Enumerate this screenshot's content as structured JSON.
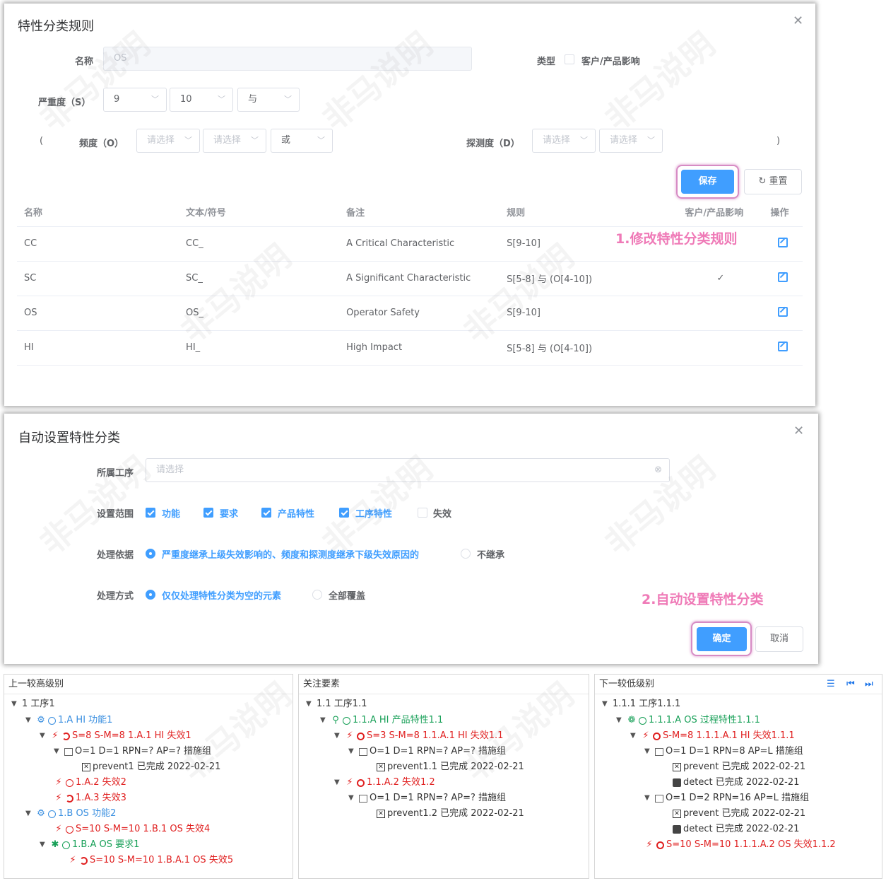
{
  "dialog1": {
    "title": "特性分类规则",
    "name_label": "名称",
    "name_value": "OS",
    "type_label": "类型",
    "type_checkbox_label": "客户/产品影响",
    "severity_label": "严重度（S）",
    "severity_from": "9",
    "severity_to": "10",
    "severity_logic": "与",
    "open_paren": "(",
    "close_paren": ")",
    "occurrence_label": "频度（O）",
    "occurrence_from": "请选择",
    "occurrence_to": "请选择",
    "occurrence_logic": "或",
    "detection_label": "探测度（D）",
    "detection_from": "请选择",
    "detection_to": "请选择",
    "save_label": "保存",
    "reset_label": "重置",
    "annotation": "1.修改特性分类规则",
    "columns": [
      "名称",
      "文本/符号",
      "备注",
      "规则",
      "客户/产品影响",
      "操作"
    ],
    "rows": [
      {
        "name": "CC",
        "symbol": "CC_",
        "note": "A Critical Characteristic",
        "rule": "S[9-10]",
        "customer": ""
      },
      {
        "name": "SC",
        "symbol": "SC_",
        "note": "A Significant Characteristic",
        "rule": "S[5-8] 与 (O[4-10])",
        "customer": "✓"
      },
      {
        "name": "OS",
        "symbol": "OS_",
        "note": "Operator Safety",
        "rule": "S[9-10]",
        "customer": ""
      },
      {
        "name": "HI",
        "symbol": "HI_",
        "note": "High Impact",
        "rule": "S[5-8] 与 (O[4-10])",
        "customer": ""
      }
    ]
  },
  "dialog2": {
    "title": "自动设置特性分类",
    "process_label": "所属工序",
    "process_placeholder": "请选择",
    "scope_label": "设置范围",
    "scope_items": [
      {
        "label": "功能",
        "checked": true
      },
      {
        "label": "要求",
        "checked": true
      },
      {
        "label": "产品特性",
        "checked": true
      },
      {
        "label": "工序特性",
        "checked": true
      },
      {
        "label": "失效",
        "checked": false
      }
    ],
    "basis_label": "处理依据",
    "basis_option1": "严重度继承上级失效影响的、频度和探测度继承下级失效原因的",
    "basis_option2": "不继承",
    "mode_label": "处理方式",
    "mode_option1": "仅仅处理特性分类为空的元素",
    "mode_option2": "全部覆盖",
    "annotation": "2.自动设置特性分类",
    "confirm_label": "确定",
    "cancel_label": "取消"
  },
  "panels": {
    "left": {
      "title": "上一较高级别",
      "nodes": [
        {
          "text": "1 工序1"
        },
        {
          "text": "1.A HI 功能1"
        },
        {
          "text": "S=8 S-M=8 1.A.1 HI 失效1"
        },
        {
          "text": "O=1 D=1 RPN=? AP=? 措施组"
        },
        {
          "text": "prevent1 已完成 2022-02-21"
        },
        {
          "text": "1.A.2 失效2"
        },
        {
          "text": "1.A.3 失效3"
        },
        {
          "text": "1.B OS 功能2"
        },
        {
          "text": "S=10 S-M=10 1.B.1 OS 失效4"
        },
        {
          "text": "1.B.A OS 要求1"
        },
        {
          "text": "S=10 S-M=10 1.B.A.1 OS 失效5"
        }
      ]
    },
    "middle": {
      "title": "关注要素",
      "nodes": [
        {
          "text": "1.1 工序1.1"
        },
        {
          "text": "1.1.A HI 产品特性1.1"
        },
        {
          "text": "S=3 S-M=8 1.1.A.1 HI 失效1.1"
        },
        {
          "text": "O=1 D=1 RPN=? AP=? 措施组"
        },
        {
          "text": "prevent1.1 已完成 2022-02-21"
        },
        {
          "text": "1.1.A.2 失效1.2"
        },
        {
          "text": "O=1 D=1 RPN=? AP=? 措施组"
        },
        {
          "text": "prevent1.2 已完成 2022-02-21"
        }
      ]
    },
    "right": {
      "title": "下一较低级别",
      "nodes": [
        {
          "text": "1.1.1 工序1.1.1"
        },
        {
          "text": "1.1.1.A OS 过程特性1.1.1"
        },
        {
          "text": "S-M=8 1.1.1.A.1 HI 失效1.1.1"
        },
        {
          "text": "O=1 D=1 RPN=8 AP=L 措施组"
        },
        {
          "text": "prevent 已完成 2022-02-21"
        },
        {
          "text": "detect 已完成 2022-02-21"
        },
        {
          "text": "O=1 D=2 RPN=16 AP=L 措施组"
        },
        {
          "text": "prevent 已完成 2022-02-21"
        },
        {
          "text": "detect 已完成 2022-02-21"
        },
        {
          "text": "S=10 S-M=10 1.1.1.A.2 OS 失效1.1.2"
        }
      ]
    }
  },
  "watermark": "非马说明",
  "colors": {
    "primary": "#409eff",
    "annotation": "#ef7ab7",
    "failure": "#e02020",
    "function": "#3a8fe0",
    "green": "#18a058"
  }
}
